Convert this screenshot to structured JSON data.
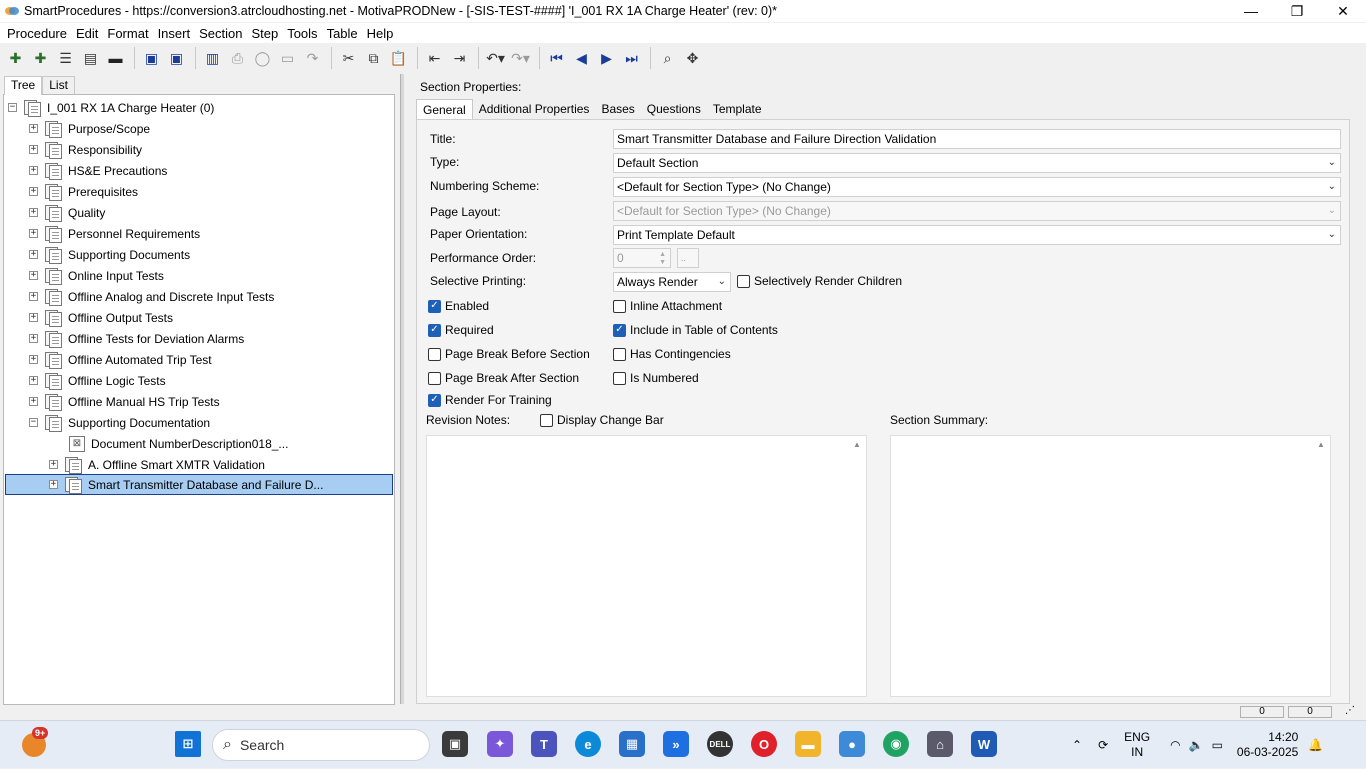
{
  "window": {
    "title": "SmartProcedures - https://conversion3.atrcloudhosting.net - MotivaPRODNew - [-SIS-TEST-####] 'I_001 RX 1A Charge Heater' (rev: 0)*",
    "min": "—",
    "max": "❐",
    "close": "✕"
  },
  "menu": [
    "Procedure",
    "Edit",
    "Format",
    "Insert",
    "Section",
    "Step",
    "Tools",
    "Table",
    "Help"
  ],
  "left_tabs": [
    "Tree",
    "List"
  ],
  "tree": {
    "root": "I_001 RX 1A Charge Heater (0)",
    "items": [
      "Purpose/Scope",
      "Responsibility",
      "HS&E Precautions",
      "Prerequisites",
      "Quality",
      "Personnel Requirements",
      "Supporting Documents",
      "Online Input Tests",
      "Offline Analog and Discrete Input Tests",
      "Offline Output Tests",
      "Offline Tests for Deviation Alarms",
      "Offline Automated Trip Test",
      "Offline Logic Tests",
      "Offline Manual HS Trip Tests",
      "Supporting Documentation"
    ],
    "children": [
      "Document NumberDescription018_...",
      "A. Offline Smart XMTR Validation",
      "Smart Transmitter Database and Failure D..."
    ]
  },
  "section_properties": {
    "heading": "Section Properties:",
    "tabs": [
      "General",
      "Additional Properties",
      "Bases",
      "Questions",
      "Template"
    ],
    "labels": {
      "title": "Title:",
      "type": "Type:",
      "numbering": "Numbering Scheme:",
      "layout": "Page Layout:",
      "orientation": "Paper Orientation:",
      "perf_order": "Performance Order:",
      "selective": "Selective Printing:"
    },
    "values": {
      "title": "Smart Transmitter Database and Failure Direction Validation",
      "type": "Default Section",
      "numbering": "<Default for Section Type> (No Change)",
      "layout": "<Default for Section Type> (No Change)",
      "orientation": "Print Template Default",
      "perf_order": "0",
      "selective": "Always Render"
    },
    "checkboxes": {
      "selectively_render_children": "Selectively Render Children",
      "enabled": "Enabled",
      "inline_attachment": "Inline Attachment",
      "required": "Required",
      "include_toc": "Include in Table of Contents",
      "page_break_before": "Page Break Before Section",
      "has_contingencies": "Has Contingencies",
      "page_break_after": "Page Break After Section",
      "is_numbered": "Is Numbered",
      "render_training": "Render For Training",
      "display_change_bar": "Display Change Bar"
    },
    "revision_notes_label": "Revision Notes:",
    "section_summary_label": "Section Summary:"
  },
  "statusbar": {
    "a": "0",
    "b": "0"
  },
  "taskbar": {
    "search": "Search",
    "badge": "9+",
    "lang": "ENG",
    "region": "IN",
    "time": "14:20",
    "date": "06-03-2025"
  }
}
